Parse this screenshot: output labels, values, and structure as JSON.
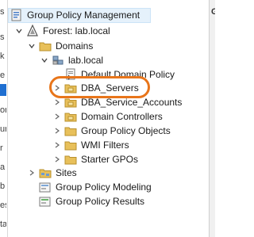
{
  "left_strip": {
    "fragments": [
      "s",
      "s",
      "k",
      "e",
      "",
      "or",
      "ur",
      "r",
      "a",
      "b",
      "es",
      "ta"
    ]
  },
  "right_strip": {
    "fragment": "G"
  },
  "tree": {
    "root": {
      "label": "Group Policy Management",
      "icon": "gpm-icon"
    },
    "forest": {
      "label": "Forest: lab.local",
      "icon": "forest-icon"
    },
    "domains": {
      "label": "Domains",
      "icon": "folder-icon"
    },
    "domain": {
      "label": "lab.local",
      "icon": "domain-icon"
    },
    "default_policy": {
      "label": "Default Domain Policy",
      "icon": "gpo-link-icon"
    },
    "dba_servers": {
      "label": "DBA_Servers",
      "icon": "ou-icon"
    },
    "dba_service_accounts": {
      "label": "DBA_Service_Accounts",
      "icon": "ou-icon"
    },
    "domain_controllers": {
      "label": "Domain Controllers",
      "icon": "ou-icon"
    },
    "gpo_objects": {
      "label": "Group Policy Objects",
      "icon": "folder-icon"
    },
    "wmi_filters": {
      "label": "WMI Filters",
      "icon": "folder-icon"
    },
    "starter_gpos": {
      "label": "Starter GPOs",
      "icon": "folder-icon"
    },
    "sites": {
      "label": "Sites",
      "icon": "sites-icon"
    },
    "modeling": {
      "label": "Group Policy Modeling",
      "icon": "modeling-icon"
    },
    "results": {
      "label": "Group Policy Results",
      "icon": "results-icon"
    }
  },
  "colors": {
    "highlight_oval": "#e8751a",
    "root_selection": "#e5f1fb",
    "folder": "#e8c05a",
    "selected_strip": "#1f6fd1"
  }
}
